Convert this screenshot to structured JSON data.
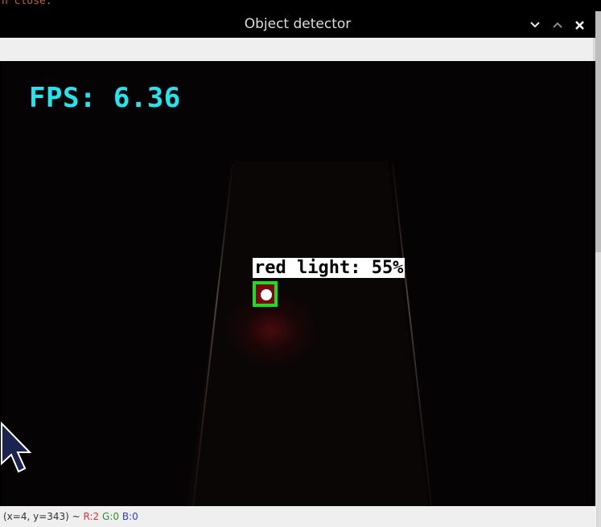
{
  "terminal": {
    "text": "n close."
  },
  "window": {
    "title": "Object detector",
    "controls": {
      "minimize": "⌄",
      "maximize": "⌃",
      "close": "✕"
    }
  },
  "overlay": {
    "fps_text": "FPS: 6.36",
    "detection_label": "red light: 55%"
  },
  "status": {
    "coords": "(x=4, y=343) ~",
    "r": "R:2",
    "g": "G:0",
    "b": "B:0"
  },
  "colors": {
    "fps": "#1fe7f0",
    "detection_box": "#18e01c",
    "status_r": "#e03030",
    "status_g": "#2e8b2e",
    "status_b": "#3040c8"
  }
}
